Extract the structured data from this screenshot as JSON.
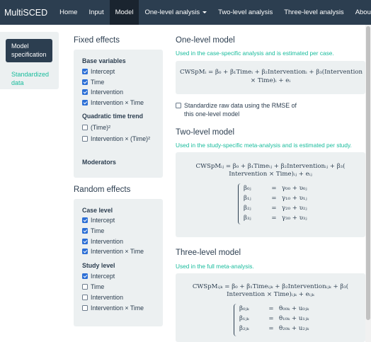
{
  "navbar": {
    "brand": "MultiSCED",
    "items": [
      {
        "label": "Home"
      },
      {
        "label": "Input"
      },
      {
        "label": "Model",
        "active": true
      },
      {
        "label": "One-level analysis",
        "dropdown": true
      },
      {
        "label": "Two-level analysis"
      },
      {
        "label": "Three-level analysis"
      },
      {
        "label": "About"
      }
    ]
  },
  "sidebar": {
    "items": [
      {
        "label": "Model specification",
        "active": true
      },
      {
        "label": "Standardized data"
      }
    ]
  },
  "fixed_effects": {
    "title": "Fixed effects",
    "base_variables_title": "Base variables",
    "base_variables": [
      {
        "label": "Intercept",
        "checked": true
      },
      {
        "label": "Time",
        "checked": true
      },
      {
        "label": "Intervention",
        "checked": true
      },
      {
        "label": "Intervention × Time",
        "checked": true
      }
    ],
    "quadratic_title": "Quadratic time trend",
    "quadratic": [
      {
        "label": "(Time)²",
        "checked": false
      },
      {
        "label": "Intervention × (Time)²",
        "checked": false
      }
    ],
    "moderators_title": "Moderators"
  },
  "random_effects": {
    "title": "Random effects",
    "case_level_title": "Case level",
    "case_level": [
      {
        "label": "Intercept",
        "checked": true
      },
      {
        "label": "Time",
        "checked": true
      },
      {
        "label": "Intervention",
        "checked": true
      },
      {
        "label": "Intervention × Time",
        "checked": true
      }
    ],
    "study_level_title": "Study level",
    "study_level": [
      {
        "label": "Intercept",
        "checked": true
      },
      {
        "label": "Time",
        "checked": false
      },
      {
        "label": "Intervention",
        "checked": false
      },
      {
        "label": "Intervention × Time",
        "checked": false
      }
    ]
  },
  "one_level": {
    "title": "One-level model",
    "description": "Used in the case-specific analysis and is estimated per case.",
    "eq_line1": "CWSpMᵢ = β₀ + β₁Timeᵢ + β₂Interventionᵢ + β₃(Intervention",
    "eq_line2": "× Time)ᵢ + eᵢ",
    "standardize_label": "Standardize raw data using the RMSE of this one-level model",
    "standardize_checked": false
  },
  "two_level": {
    "title": "Two-level model",
    "description": "Used in the study-specific meta-analysis and is estimated per study.",
    "eq_line1": "CWSpMᵢⱼ = β₀ + β₁Timeᵢⱼ + β₂Interventionᵢⱼ + β₃(",
    "eq_line2": "Intervention × Time)ᵢⱼ + eᵢⱼ",
    "system": [
      {
        "lhs": "β₀ⱼ",
        "rhs": "γ₀₀ + υ₀ⱼ"
      },
      {
        "lhs": "β₁ⱼ",
        "rhs": "γ₁₀ + υ₁ⱼ"
      },
      {
        "lhs": "β₂ⱼ",
        "rhs": "γ₂₀ + υ₂ⱼ"
      },
      {
        "lhs": "β₃ⱼ",
        "rhs": "γ₃₀ + υ₃ⱼ"
      }
    ]
  },
  "three_level": {
    "title": "Three-level model",
    "description": "Used in the full meta-analysis.",
    "eq_line1": "CWSpMᵢⱼₖ = β₀ + β₁Timeᵢⱼₖ + β₂Interventionᵢⱼₖ + β₃(",
    "eq_line2": "Intervention × Time)ᵢⱼₖ + eᵢⱼₖ",
    "system": [
      {
        "lhs": "β₀ⱼₖ",
        "rhs": "θ₀₀ₖ + u₀ⱼₖ"
      },
      {
        "lhs": "β₁ⱼₖ",
        "rhs": "θ₁₀ₖ + u₁ⱼₖ"
      },
      {
        "lhs": "β₂ⱼₖ",
        "rhs": "θ₂₀ₖ + u₂ⱼₖ"
      }
    ]
  },
  "colors": {
    "navbar": "#2c3e50",
    "active": "#1a242f",
    "accent": "#18bc9c",
    "panel": "#ecf0f1",
    "checkbox": "#2c6fd6"
  }
}
